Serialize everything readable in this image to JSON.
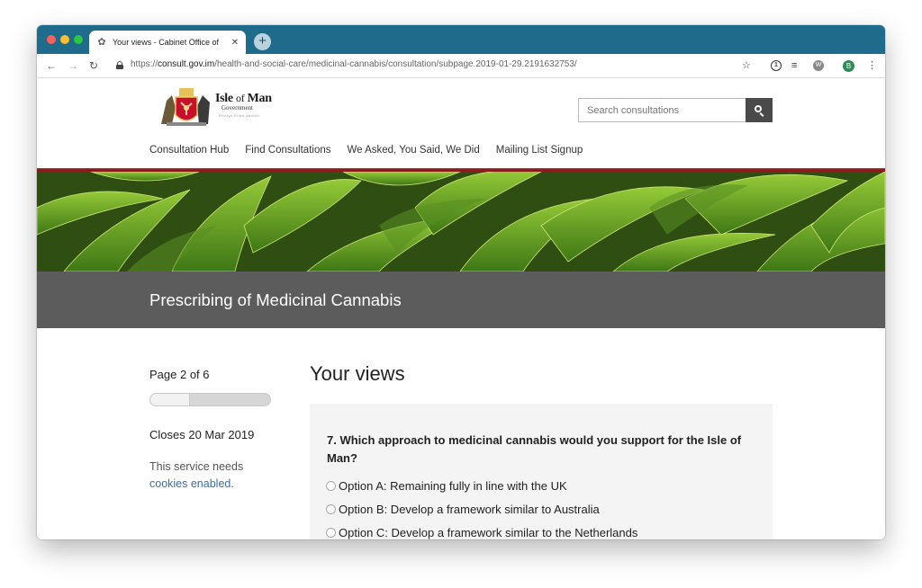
{
  "browser": {
    "tab_title": "Your views - Cabinet Office of",
    "new_tab": "+",
    "url_prefix": "https://",
    "url_host": "consult.gov.im",
    "url_path": "/health-and-social-care/medicinal-cannabis/consultation/subpage.2019-01-29.2191632753/",
    "profile_initial": "B"
  },
  "header": {
    "logo_title": "Isle",
    "logo_of": "of",
    "logo_man": "Man",
    "logo_sub": "Government",
    "logo_gaelic": "Reiltys Ellan Vannin",
    "search_placeholder": "Search consultations",
    "nav": [
      "Consultation Hub",
      "Find Consultations",
      "We Asked, You Said, We Did",
      "Mailing List Signup"
    ]
  },
  "consultation": {
    "title": "Prescribing of Medicinal Cannabis"
  },
  "sidebar": {
    "page_indicator": "Page 2 of 6",
    "progress_fraction": 0.333,
    "closes": "Closes 20 Mar 2019",
    "cookie_text": "This service needs",
    "cookie_link": "cookies enabled",
    "cookie_end": "."
  },
  "main": {
    "section_title": "Your views",
    "question": "7. Which approach to medicinal cannabis would you support for the Isle of Man?",
    "options": [
      "Option A: Remaining fully in line with the UK",
      "Option B: Develop a framework similar to Australia",
      "Option C: Develop a framework similar to the Netherlands"
    ]
  }
}
